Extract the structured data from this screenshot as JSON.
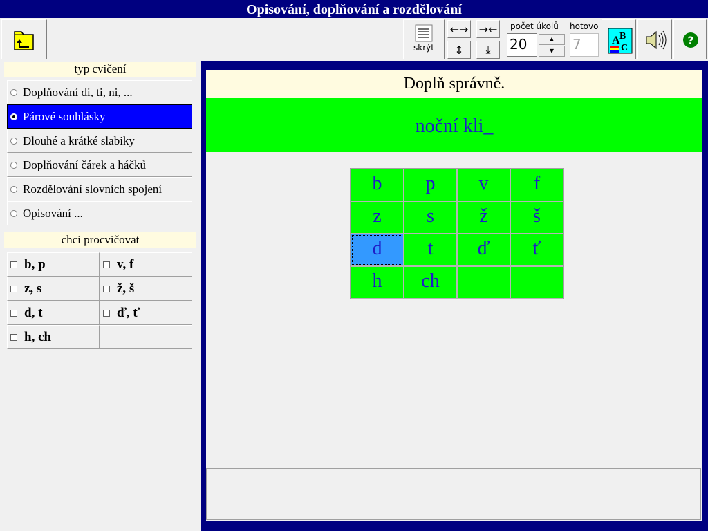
{
  "window": {
    "title": "Opisování, doplňování a rozdělování"
  },
  "toolbar": {
    "hide_label": "skrýt",
    "task_count_label": "počet úkolů",
    "task_count_value": "20",
    "done_label": "hotovo",
    "done_value": "7",
    "icons": [
      "folder-up-icon",
      "hide-icon",
      "widen-icon",
      "narrow-icon",
      "taller-icon",
      "shorter-icon",
      "spin-up-icon",
      "spin-down-icon",
      "abc-icon",
      "speaker-icon",
      "help-icon"
    ]
  },
  "exercise_type": {
    "header": "typ cvičení",
    "options": [
      {
        "label": "Doplňování di, ti, ni, ..."
      },
      {
        "label": "Párové souhlásky"
      },
      {
        "label": "Dlouhé a krátké slabiky"
      },
      {
        "label": "Doplňování čárek a háčků"
      },
      {
        "label": "Rozdělování slovních spojení"
      },
      {
        "label": "Opisování ..."
      }
    ],
    "selected": "Párové souhlásky"
  },
  "practice": {
    "header": "chci procvičovat",
    "options": [
      {
        "label": "b, p"
      },
      {
        "label": "v, f"
      },
      {
        "label": "z, s"
      },
      {
        "label": "ž, š"
      },
      {
        "label": "d, t"
      },
      {
        "label": "ď, ť"
      },
      {
        "label": "h, ch"
      }
    ]
  },
  "main": {
    "instruction": "Doplň správně.",
    "task": "noční kli_",
    "letters": [
      "b",
      "p",
      "v",
      "f",
      "z",
      "s",
      "ž",
      "š",
      "d",
      "t",
      "ď",
      "ť",
      "h",
      "ch",
      "",
      ""
    ],
    "selected_letter": "d"
  },
  "colors": {
    "title_bg": "#000080",
    "selected": "#0000ff",
    "cell_bg": "#00ff00",
    "letter_text": "#1e1ec8",
    "cell_selected": "#3399ff"
  }
}
